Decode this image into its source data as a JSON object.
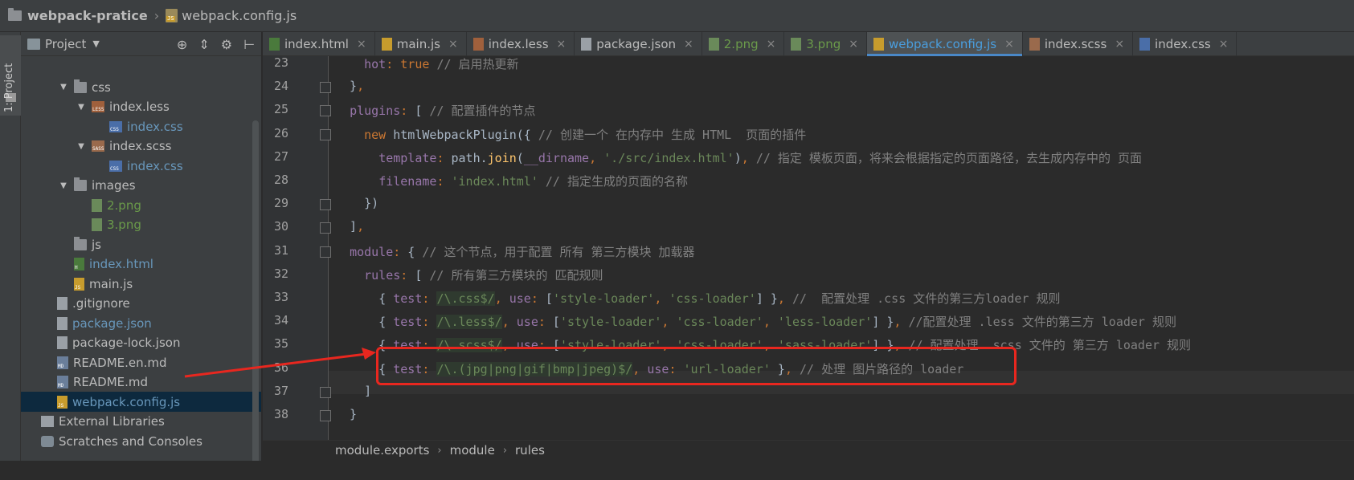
{
  "titlebar": {
    "project": "webpack-pratice",
    "file": "webpack.config.js"
  },
  "toolstrip": {
    "tab_label": "1: Project"
  },
  "panel": {
    "title": "Project"
  },
  "tree": [
    {
      "label": "css",
      "kind": "folder",
      "color": "norm",
      "twisty": "▼"
    },
    {
      "label": "index.less",
      "kind": "less",
      "color": "norm",
      "twisty": "▼"
    },
    {
      "label": "index.css",
      "kind": "css",
      "color": "blue",
      "twisty": ""
    },
    {
      "label": "index.scss",
      "kind": "sass",
      "color": "norm",
      "twisty": "▼"
    },
    {
      "label": "index.css",
      "kind": "css",
      "color": "blue",
      "twisty": ""
    },
    {
      "label": "images",
      "kind": "folder",
      "color": "norm",
      "twisty": "▼"
    },
    {
      "label": "2.png",
      "kind": "png",
      "color": "green",
      "twisty": ""
    },
    {
      "label": "3.png",
      "kind": "png",
      "color": "green",
      "twisty": ""
    },
    {
      "label": "js",
      "kind": "folder",
      "color": "norm",
      "twisty": ""
    },
    {
      "label": "index.html",
      "kind": "html",
      "color": "blue",
      "twisty": ""
    },
    {
      "label": "main.js",
      "kind": "js",
      "color": "norm",
      "twisty": ""
    },
    {
      "label": ".gitignore",
      "kind": "file",
      "color": "norm",
      "twisty": ""
    },
    {
      "label": "package.json",
      "kind": "json",
      "color": "blue",
      "twisty": ""
    },
    {
      "label": "package-lock.json",
      "kind": "json",
      "color": "norm",
      "twisty": ""
    },
    {
      "label": "README.en.md",
      "kind": "md",
      "color": "norm",
      "twisty": ""
    },
    {
      "label": "README.md",
      "kind": "md",
      "color": "norm",
      "twisty": ""
    },
    {
      "label": "webpack.config.js",
      "kind": "js",
      "color": "blue",
      "twisty": "",
      "selected": true
    },
    {
      "label": "External Libraries",
      "kind": "lib",
      "color": "norm",
      "twisty": ""
    },
    {
      "label": "Scratches and Consoles",
      "kind": "scratch",
      "color": "norm",
      "twisty": ""
    }
  ],
  "tabs": [
    {
      "label": "index.html",
      "icon": "html"
    },
    {
      "label": "main.js",
      "icon": "js"
    },
    {
      "label": "index.less",
      "icon": "less"
    },
    {
      "label": "package.json",
      "icon": "json"
    },
    {
      "label": "2.png",
      "icon": "png"
    },
    {
      "label": "3.png",
      "icon": "png"
    },
    {
      "label": "webpack.config.js",
      "icon": "js",
      "active": true
    },
    {
      "label": "index.scss",
      "icon": "sass"
    },
    {
      "label": "index.css",
      "icon": "css"
    }
  ],
  "editor": {
    "line_numbers": [
      "23",
      "24",
      "25",
      "26",
      "27",
      "28",
      "29",
      "30",
      "31",
      "32",
      "33",
      "34",
      "35",
      "36",
      "37",
      "38"
    ],
    "lines": [
      "    hot: true // 启用热更新",
      "  },",
      "  plugins: [ // 配置插件的节点",
      "    new htmlWebpackPlugin({ // 创建一个 在内存中 生成 HTML  页面的插件",
      "      template: path.join(__dirname, './src/index.html'), // 指定 模板页面，将来会根据指定的页面路径，去生成内存中的 页面",
      "      filename: 'index.html' // 指定生成的页面的名称",
      "    })",
      "  ],",
      "  module: { // 这个节点，用于配置 所有 第三方模块 加载器",
      "    rules: [ // 所有第三方模块的 匹配规则",
      "      { test: /\\.css$/, use: ['style-loader', 'css-loader'] }, //  配置处理 .css 文件的第三方loader 规则",
      "      { test: /\\.less$/, use: ['style-loader', 'css-loader', 'less-loader'] }, //配置处理 .less 文件的第三方 loader 规则",
      "      { test: /\\.scss$/, use: ['style-loader', 'css-loader', 'sass-loader'] }, // 配置处理 .scss 文件的 第三方 loader 规则",
      "      { test: /\\.(jpg|png|gif|bmp|jpeg)$/, use: 'url-loader' }, // 处理 图片路径的 loader",
      "    ]",
      "  }"
    ]
  },
  "breadcrumbs": [
    "module.exports",
    "module",
    "rules"
  ],
  "annotation": {
    "highlight_color": "#e8271f"
  }
}
